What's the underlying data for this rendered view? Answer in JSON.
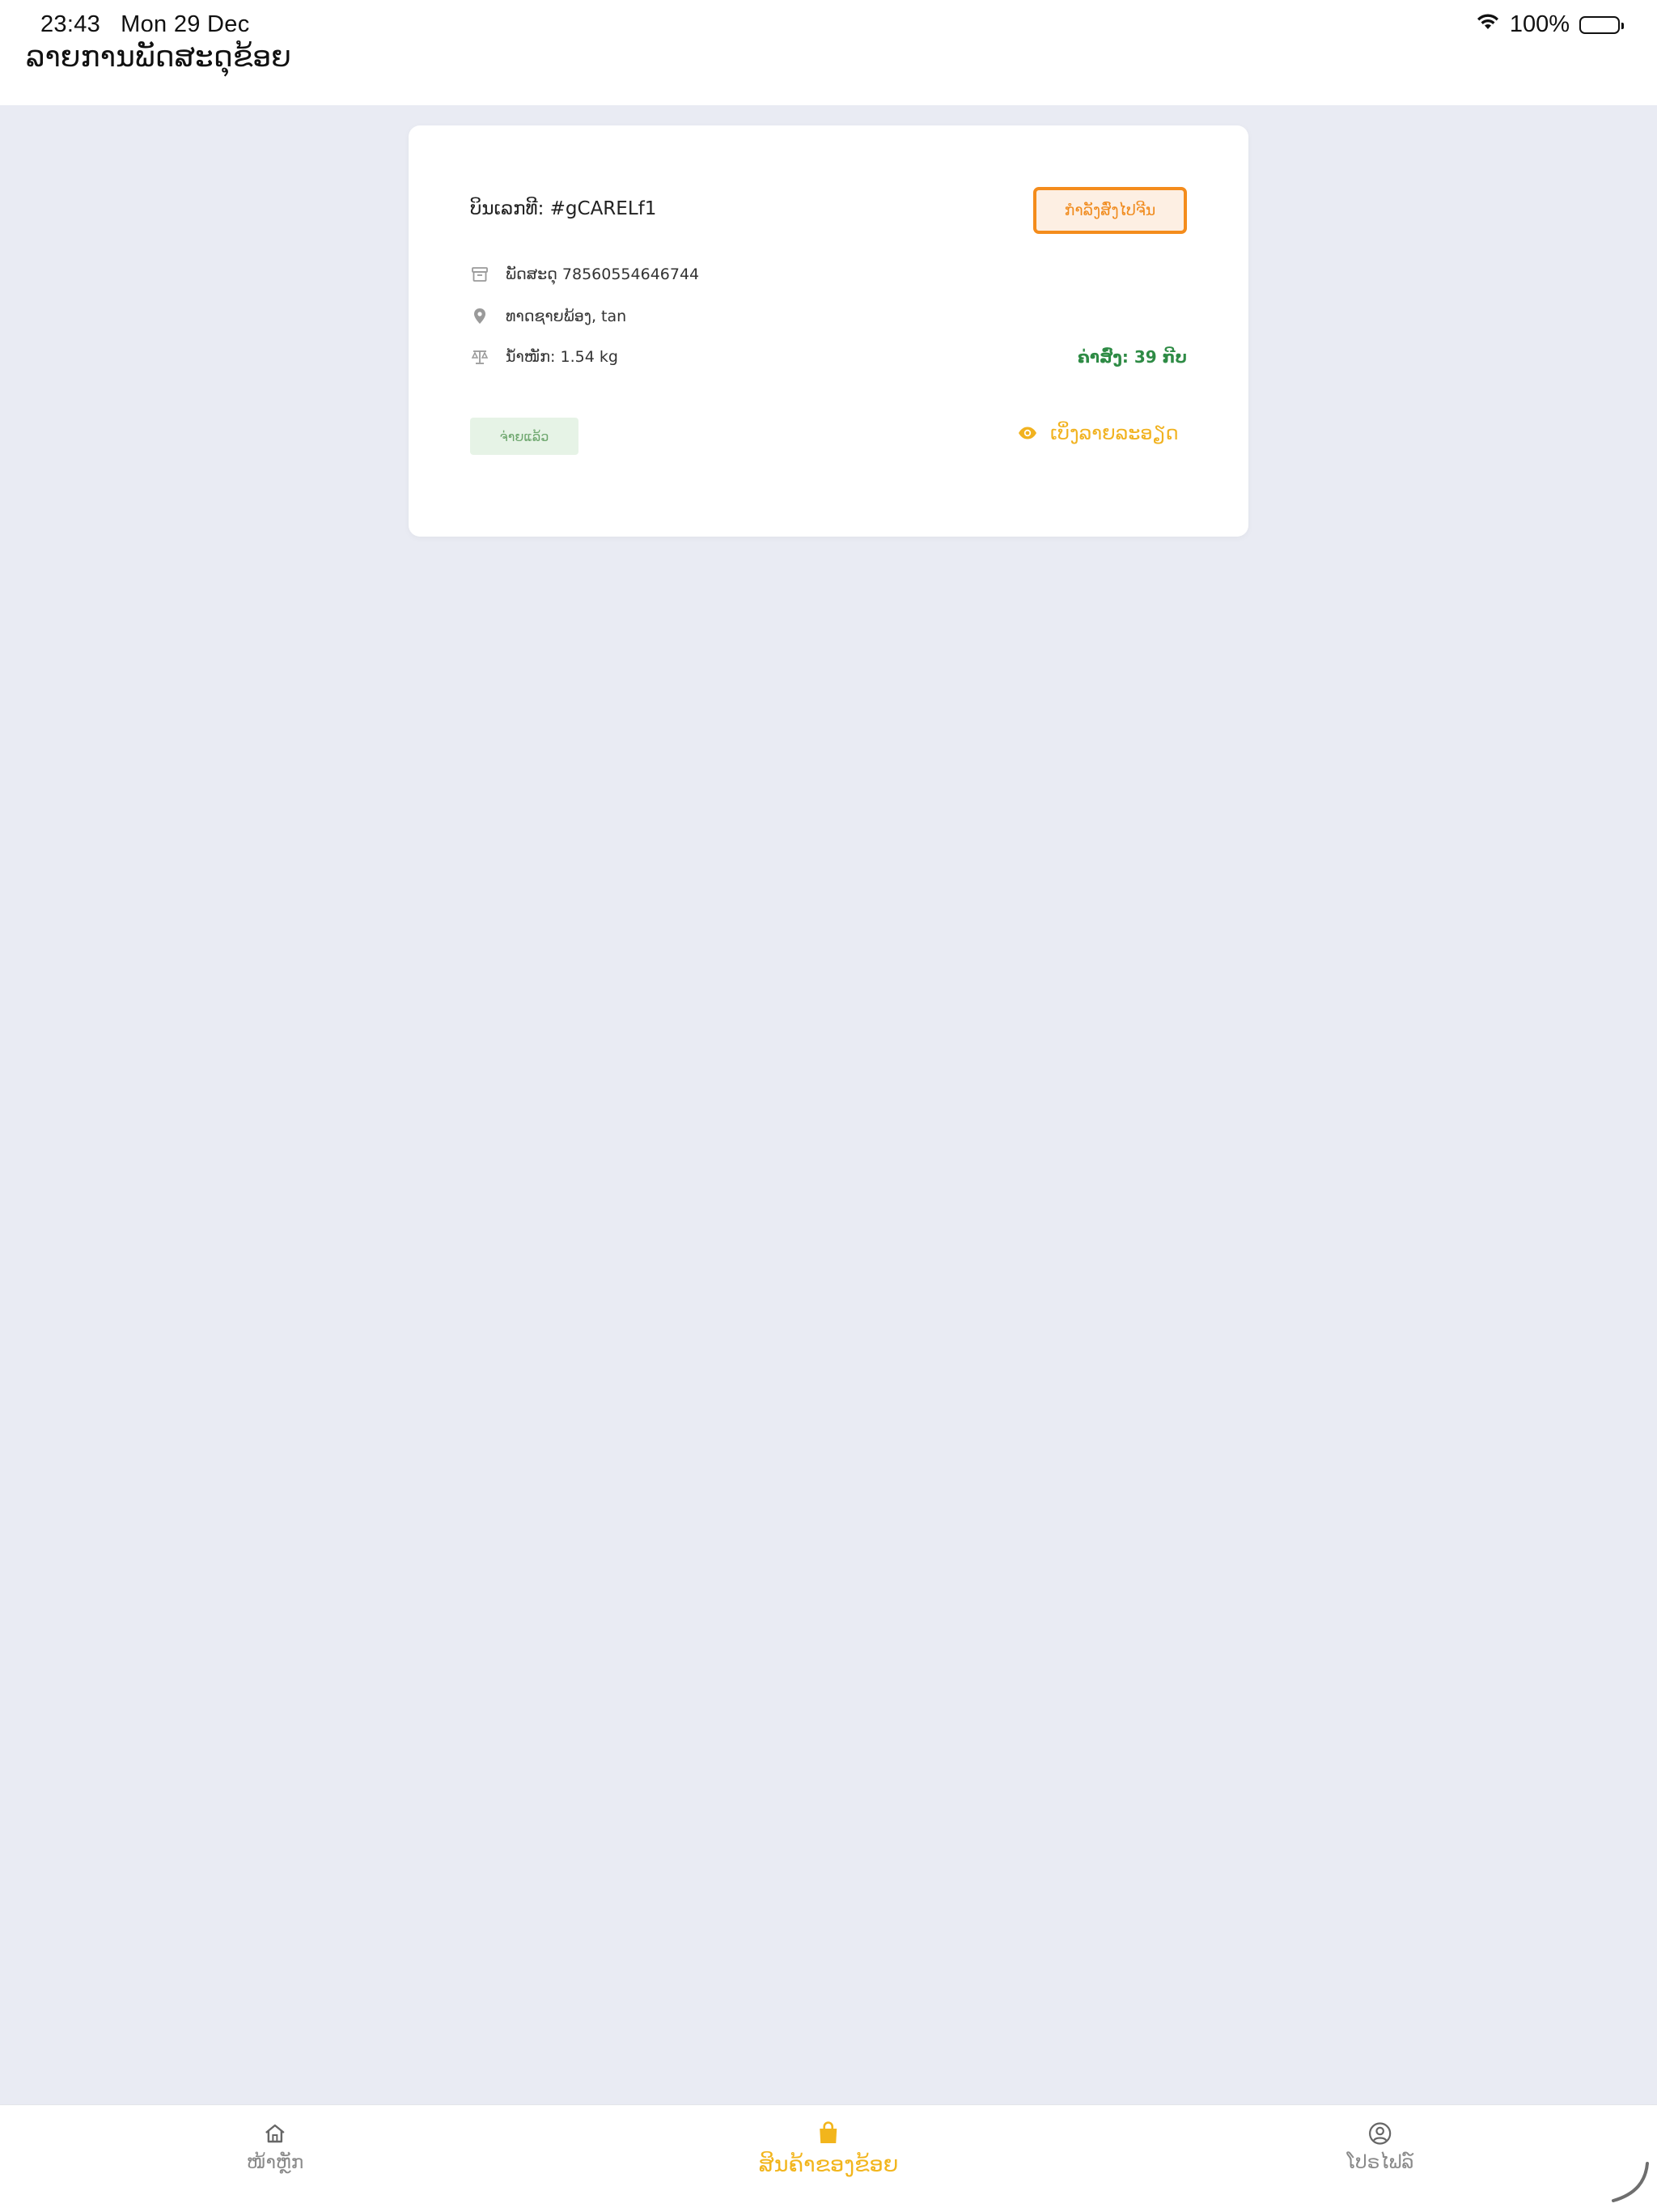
{
  "status_bar": {
    "time": "23:43",
    "date": "Mon 29 Dec",
    "battery": "100%"
  },
  "header": {
    "title": "ລາຍການພັດສະດຸຂ້ອຍ"
  },
  "order": {
    "bill_number": "ບິນເລກທີ: #gCARELf1",
    "status_button": "ກຳລັງສົ່ງໄປຈີນ",
    "parcel": "ພັດສະດຸ 78560554646744",
    "location": "ທາດຊາຍພ້ອງ, tan",
    "weight": "ນ້ຳໜັກ: 1.54 kg",
    "price": "ຄ່າສົ່ງ: 39 ກີບ",
    "payment_status": "ຈ່າຍແລ້ວ",
    "view_details": "ເບິ່ງລາຍລະອຽດ"
  },
  "bottom_nav": {
    "items": [
      {
        "label": "ໜ້າຫຼັກ",
        "icon": "home-icon",
        "active": false
      },
      {
        "label": "ສິນຄ້າຂອງຂ້ອຍ",
        "icon": "shopping-bag-icon",
        "active": true
      },
      {
        "label": "ໂປຣໄຟລ໌",
        "icon": "user-circle-icon",
        "active": false
      }
    ]
  },
  "colors": {
    "accent": "#f2b51c",
    "status_orange": "#f48c1c",
    "price_green": "#2e8b45",
    "background": "#e9ebf3"
  }
}
